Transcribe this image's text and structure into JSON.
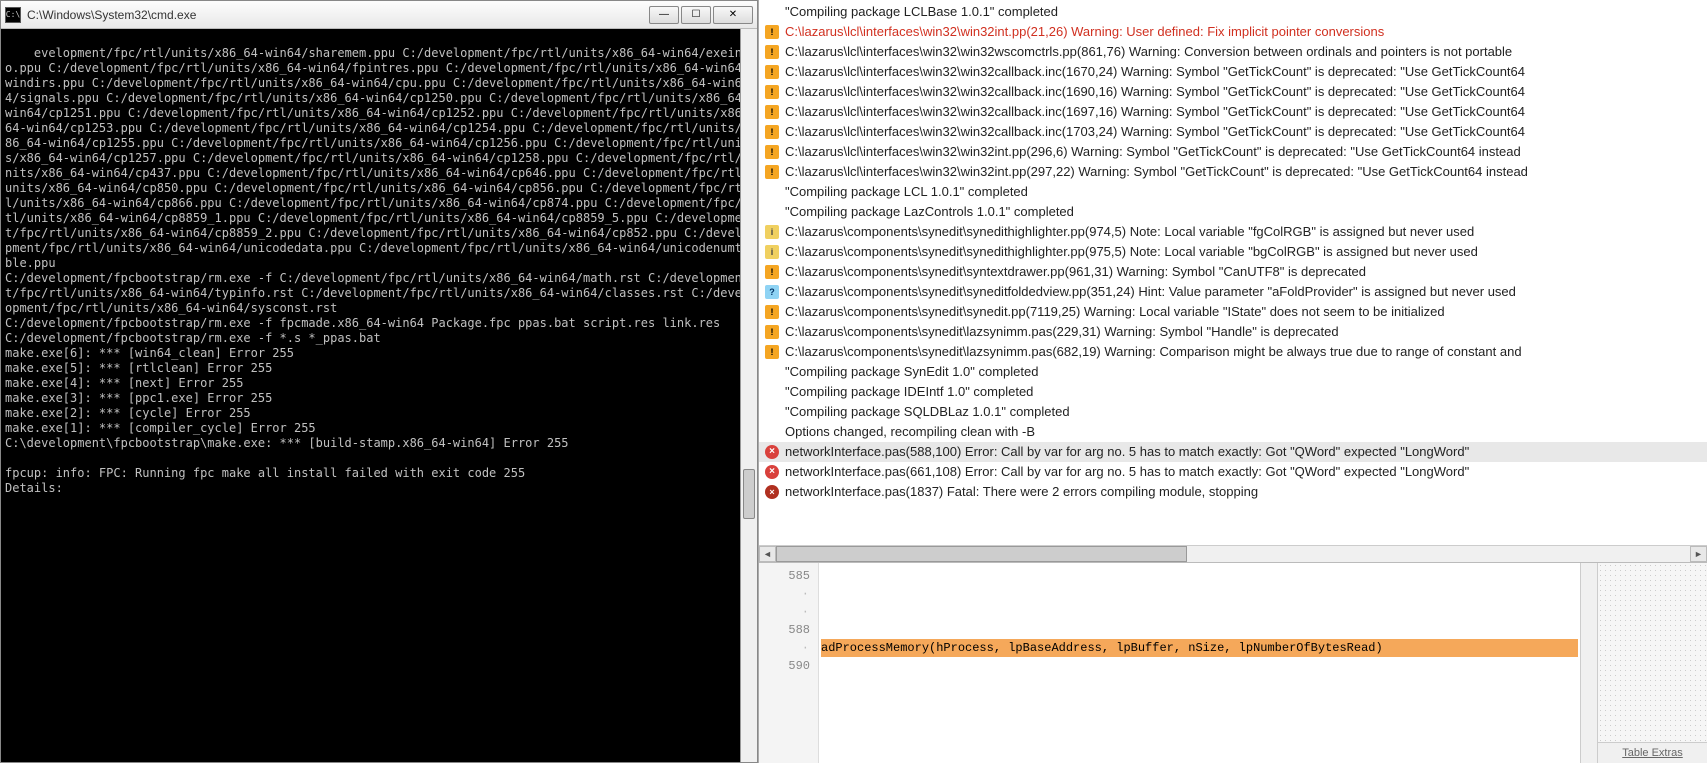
{
  "cmd": {
    "title": "C:\\Windows\\System32\\cmd.exe",
    "body": "evelopment/fpc/rtl/units/x86_64-win64/sharemem.ppu C:/development/fpc/rtl/units/x86_64-win64/exeinfo.ppu C:/development/fpc/rtl/units/x86_64-win64/fpintres.ppu C:/development/fpc/rtl/units/x86_64-win64/windirs.ppu C:/development/fpc/rtl/units/x86_64-win64/cpu.ppu C:/development/fpc/rtl/units/x86_64-win64/signals.ppu C:/development/fpc/rtl/units/x86_64-win64/cp1250.ppu C:/development/fpc/rtl/units/x86_64-win64/cp1251.ppu C:/development/fpc/rtl/units/x86_64-win64/cp1252.ppu C:/development/fpc/rtl/units/x86_64-win64/cp1253.ppu C:/development/fpc/rtl/units/x86_64-win64/cp1254.ppu C:/development/fpc/rtl/units/x86_64-win64/cp1255.ppu C:/development/fpc/rtl/units/x86_64-win64/cp1256.ppu C:/development/fpc/rtl/units/x86_64-win64/cp1257.ppu C:/development/fpc/rtl/units/x86_64-win64/cp1258.ppu C:/development/fpc/rtl/units/x86_64-win64/cp437.ppu C:/development/fpc/rtl/units/x86_64-win64/cp646.ppu C:/development/fpc/rtl/units/x86_64-win64/cp850.ppu C:/development/fpc/rtl/units/x86_64-win64/cp856.ppu C:/development/fpc/rtl/units/x86_64-win64/cp866.ppu C:/development/fpc/rtl/units/x86_64-win64/cp874.ppu C:/development/fpc/rtl/units/x86_64-win64/cp8859_1.ppu C:/development/fpc/rtl/units/x86_64-win64/cp8859_5.ppu C:/development/fpc/rtl/units/x86_64-win64/cp8859_2.ppu C:/development/fpc/rtl/units/x86_64-win64/cp852.ppu C:/development/fpc/rtl/units/x86_64-win64/unicodedata.ppu C:/development/fpc/rtl/units/x86_64-win64/unicodenumtable.ppu\nC:/development/fpcbootstrap/rm.exe -f C:/development/fpc/rtl/units/x86_64-win64/math.rst C:/development/fpc/rtl/units/x86_64-win64/typinfo.rst C:/development/fpc/rtl/units/x86_64-win64/classes.rst C:/development/fpc/rtl/units/x86_64-win64/sysconst.rst\nC:/development/fpcbootstrap/rm.exe -f fpcmade.x86_64-win64 Package.fpc ppas.bat script.res link.res\nC:/development/fpcbootstrap/rm.exe -f *.s *_ppas.bat\nmake.exe[6]: *** [win64_clean] Error 255\nmake.exe[5]: *** [rtlclean] Error 255\nmake.exe[4]: *** [next] Error 255\nmake.exe[3]: *** [ppc1.exe] Error 255\nmake.exe[2]: *** [cycle] Error 255\nmake.exe[1]: *** [compiler_cycle] Error 255\nC:\\development\\fpcbootstrap\\make.exe: *** [build-stamp.x86_64-win64] Error 255\n\nfpcup: info: FPC: Running fpc make all install failed with exit code 255\nDetails:"
  },
  "messages": [
    {
      "icon": "none",
      "text": "\"Compiling package LCLBase 1.0.1\" completed"
    },
    {
      "icon": "warn",
      "red": true,
      "text": "C:\\lazarus\\lcl\\interfaces\\win32\\win32int.pp(21,26) Warning: User defined: Fix implicit pointer conversions"
    },
    {
      "icon": "warn",
      "text": "C:\\lazarus\\lcl\\interfaces\\win32\\win32wscomctrls.pp(861,76) Warning: Conversion between ordinals and pointers is not portable"
    },
    {
      "icon": "warn",
      "text": "C:\\lazarus\\lcl\\interfaces\\win32\\win32callback.inc(1670,24) Warning: Symbol \"GetTickCount\" is deprecated: \"Use GetTickCount64"
    },
    {
      "icon": "warn",
      "text": "C:\\lazarus\\lcl\\interfaces\\win32\\win32callback.inc(1690,16) Warning: Symbol \"GetTickCount\" is deprecated: \"Use GetTickCount64"
    },
    {
      "icon": "warn",
      "text": "C:\\lazarus\\lcl\\interfaces\\win32\\win32callback.inc(1697,16) Warning: Symbol \"GetTickCount\" is deprecated: \"Use GetTickCount64"
    },
    {
      "icon": "warn",
      "text": "C:\\lazarus\\lcl\\interfaces\\win32\\win32callback.inc(1703,24) Warning: Symbol \"GetTickCount\" is deprecated: \"Use GetTickCount64"
    },
    {
      "icon": "warn",
      "text": "C:\\lazarus\\lcl\\interfaces\\win32\\win32int.pp(296,6) Warning: Symbol \"GetTickCount\" is deprecated: \"Use GetTickCount64 instead"
    },
    {
      "icon": "warn",
      "text": "C:\\lazarus\\lcl\\interfaces\\win32\\win32int.pp(297,22) Warning: Symbol \"GetTickCount\" is deprecated: \"Use GetTickCount64 instead"
    },
    {
      "icon": "none",
      "text": "\"Compiling package LCL 1.0.1\" completed"
    },
    {
      "icon": "none",
      "text": "\"Compiling package LazControls 1.0.1\" completed"
    },
    {
      "icon": "note",
      "text": "C:\\lazarus\\components\\synedit\\synedithighlighter.pp(974,5) Note: Local variable \"fgColRGB\" is assigned but never used"
    },
    {
      "icon": "note",
      "text": "C:\\lazarus\\components\\synedit\\synedithighlighter.pp(975,5) Note: Local variable \"bgColRGB\" is assigned but never used"
    },
    {
      "icon": "warn",
      "text": "C:\\lazarus\\components\\synedit\\syntextdrawer.pp(961,31) Warning: Symbol \"CanUTF8\" is deprecated"
    },
    {
      "icon": "hint",
      "text": "C:\\lazarus\\components\\synedit\\syneditfoldedview.pp(351,24) Hint: Value parameter \"aFoldProvider\" is assigned but never used"
    },
    {
      "icon": "warn",
      "text": "C:\\lazarus\\components\\synedit\\synedit.pp(7119,25) Warning: Local variable \"IState\" does not seem to be initialized"
    },
    {
      "icon": "warn",
      "text": "C:\\lazarus\\components\\synedit\\lazsynimm.pas(229,31) Warning: Symbol \"Handle\" is deprecated"
    },
    {
      "icon": "warn",
      "text": "C:\\lazarus\\components\\synedit\\lazsynimm.pas(682,19) Warning: Comparison might be always true due to range of constant and"
    },
    {
      "icon": "none",
      "text": "\"Compiling package SynEdit 1.0\" completed"
    },
    {
      "icon": "none",
      "text": "\"Compiling package IDEIntf 1.0\" completed"
    },
    {
      "icon": "none",
      "text": "\"Compiling package SQLDBLaz 1.0.1\" completed"
    },
    {
      "icon": "none",
      "text": "Options changed, recompiling clean with -B"
    },
    {
      "icon": "err",
      "selected": true,
      "text": "networkInterface.pas(588,100) Error: Call by var for arg no. 5 has to match exactly: Got \"QWord\" expected \"LongWord\""
    },
    {
      "icon": "err",
      "text": "networkInterface.pas(661,108) Error: Call by var for arg no. 5 has to match exactly: Got \"QWord\" expected \"LongWord\""
    },
    {
      "icon": "fatal",
      "text": "networkInterface.pas(1837) Fatal: There were 2 errors compiling module, stopping"
    }
  ],
  "editor": {
    "gutter": [
      "",
      "585",
      ".",
      ".",
      "588",
      ".",
      "590",
      ""
    ],
    "highlight_line_index": 4,
    "code": "adProcessMemory(hProcess, lpBaseAddress, lpBuffer, nSize, lpNumberOfBytesRead)",
    "side_label": "Table Extras"
  }
}
